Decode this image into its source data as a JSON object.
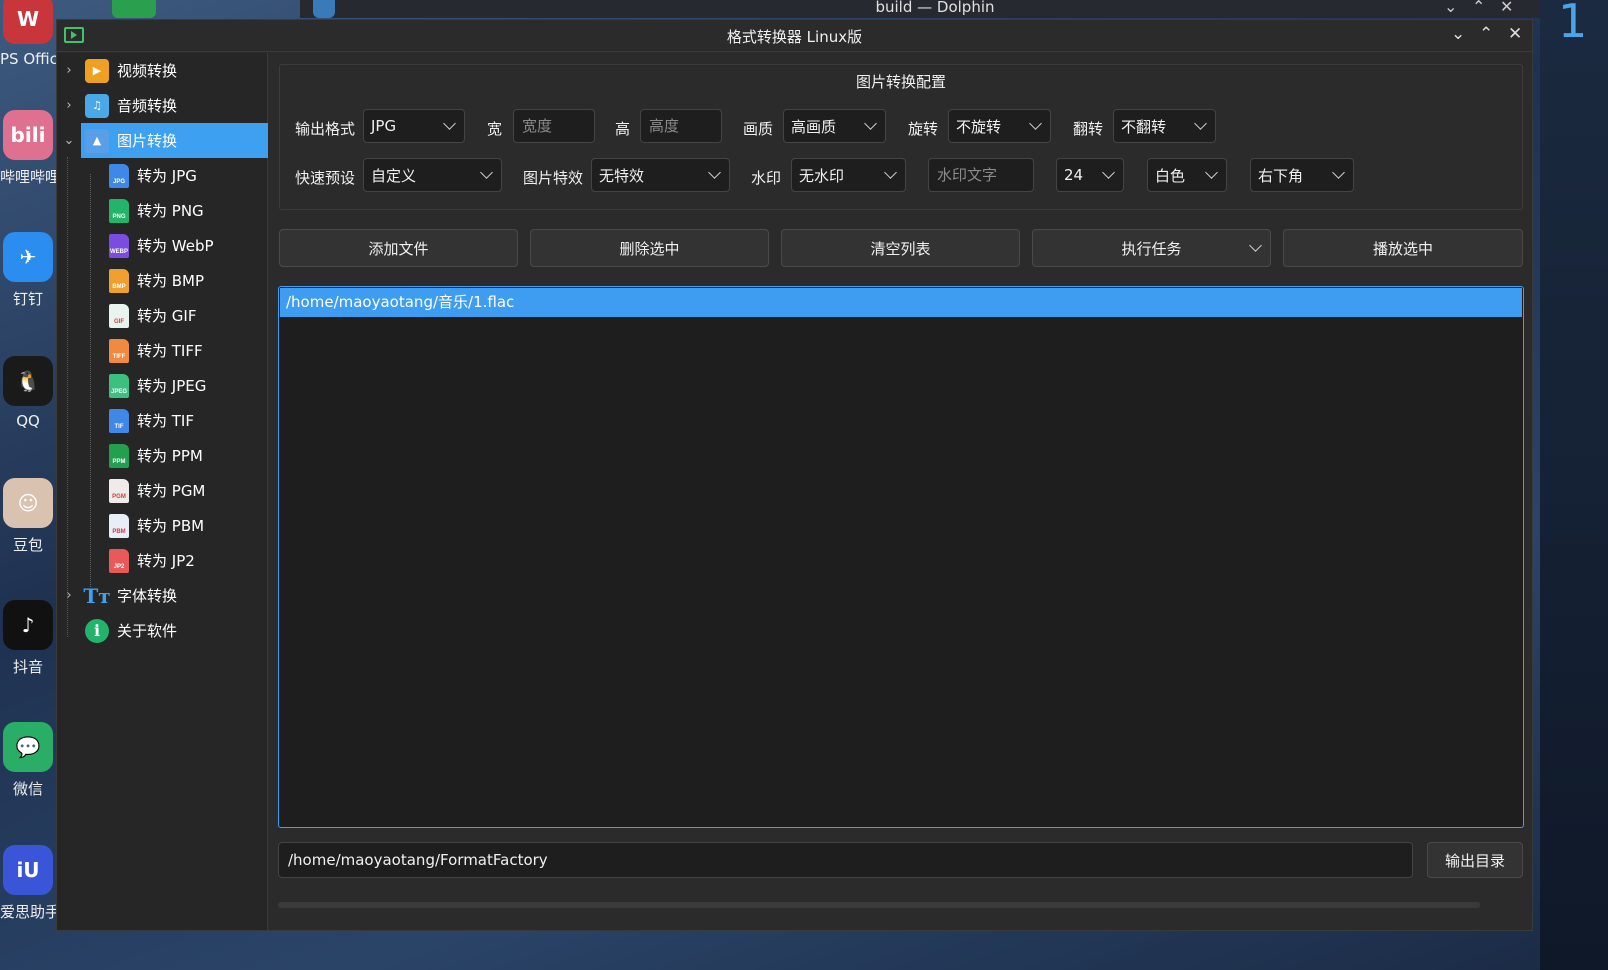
{
  "desktop": {
    "dolphin_title": "build — Dolphin",
    "dock": [
      {
        "label": "PS Office",
        "icon": "wps-icon",
        "color": "#c8363c",
        "glyph": "W"
      },
      {
        "label": "哔哩哔哩",
        "icon": "bilibili-icon",
        "color": "#e0708f",
        "glyph": "bili"
      },
      {
        "label": "钉钉",
        "icon": "dingtalk-icon",
        "color": "#2b8df0",
        "glyph": "✈"
      },
      {
        "label": "QQ",
        "icon": "qq-icon",
        "color": "#1a1a1a",
        "glyph": "🐧"
      },
      {
        "label": "豆包",
        "icon": "doubao-icon",
        "color": "#d9c2b0",
        "glyph": "☺"
      },
      {
        "label": "抖音",
        "icon": "douyin-icon",
        "color": "#111111",
        "glyph": "♪"
      },
      {
        "label": "微信",
        "icon": "wechat-icon",
        "color": "#2aae67",
        "glyph": "💬"
      },
      {
        "label": "爱思助手",
        "icon": "i4-icon",
        "color": "#3a55d8",
        "glyph": "iU"
      }
    ]
  },
  "window": {
    "title": "格式转换器 Linux版"
  },
  "sidebar": {
    "top_items": [
      {
        "label": "视频转换",
        "expanded": false,
        "icon": "video-icon",
        "color": "#f0a020"
      },
      {
        "label": "音频转换",
        "expanded": false,
        "icon": "audio-icon",
        "color": "#4aa8e8"
      },
      {
        "label": "图片转换",
        "expanded": true,
        "selected": true,
        "icon": "image-icon",
        "color": "#5a9ee8"
      }
    ],
    "children": [
      {
        "label": "转为 JPG",
        "tag": "JPG",
        "color": "#3f88e8"
      },
      {
        "label": "转为 PNG",
        "tag": "PNG",
        "color": "#22b46a"
      },
      {
        "label": "转为 WebP",
        "tag": "WEBP",
        "color": "#7a4de0"
      },
      {
        "label": "转为 BMP",
        "tag": "BMP",
        "color": "#f0a030"
      },
      {
        "label": "转为 GIF",
        "tag": "GIF",
        "color": "#e8f4f0"
      },
      {
        "label": "转为 TIFF",
        "tag": "TIFF",
        "color": "#f08a40"
      },
      {
        "label": "转为 JPEG",
        "tag": "JPEG",
        "color": "#3cc080"
      },
      {
        "label": "转为 TIF",
        "tag": "TIF",
        "color": "#3f88e8"
      },
      {
        "label": "转为 PPM",
        "tag": "PPM",
        "color": "#22a050"
      },
      {
        "label": "转为 PGM",
        "tag": "PGM",
        "color": "#f0eaea"
      },
      {
        "label": "转为 PBM",
        "tag": "PBM",
        "color": "#e8eef8"
      },
      {
        "label": "转为 JP2",
        "tag": "JP2",
        "color": "#e85a5a"
      }
    ],
    "bottom_items": [
      {
        "label": "字体转换",
        "icon": "font-icon",
        "color": "#3da0f0"
      },
      {
        "label": "关于软件",
        "icon": "info-icon",
        "color": "#22b46a"
      }
    ]
  },
  "config": {
    "title": "图片转换配置",
    "output_format_label": "输出格式",
    "output_format": "JPG",
    "width_label": "宽",
    "width_placeholder": "宽度",
    "height_label": "高",
    "height_placeholder": "高度",
    "quality_label": "画质",
    "quality": "高画质",
    "rotate_label": "旋转",
    "rotate": "不旋转",
    "flip_label": "翻转",
    "flip": "不翻转",
    "preset_label": "快速预设",
    "preset": "自定义",
    "effect_label": "图片特效",
    "effect": "无特效",
    "watermark_label": "水印",
    "watermark": "无水印",
    "watermark_text_placeholder": "水印文字",
    "font_size": "24",
    "color": "白色",
    "position": "右下角"
  },
  "actions": {
    "add_files": "添加文件",
    "delete_selected": "删除选中",
    "clear_list": "清空列表",
    "run_task": "执行任务",
    "play_selected": "播放选中"
  },
  "file_list": [
    "/home/maoyaotang/音乐/1.flac"
  ],
  "output": {
    "dir": "/home/maoyaotang/FormatFactory",
    "button": "输出目录"
  },
  "progress": 1.0
}
